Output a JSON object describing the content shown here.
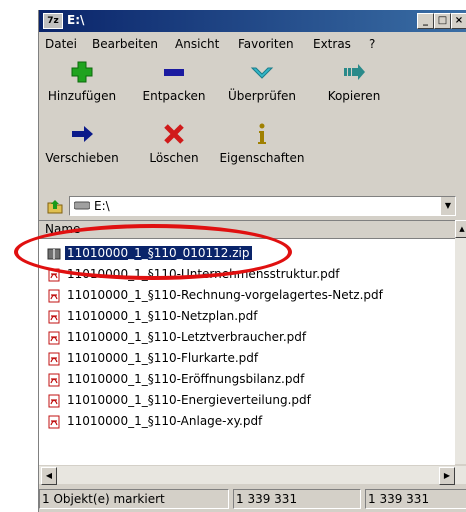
{
  "window": {
    "title": "E:\\",
    "app_icon_text": "7z",
    "min_label": "_",
    "max_label": "□",
    "close_label": "×"
  },
  "menu": [
    {
      "label": "Datei"
    },
    {
      "label": "Bearbeiten"
    },
    {
      "label": "Ansicht"
    },
    {
      "label": "Favoriten"
    },
    {
      "label": "Extras"
    },
    {
      "label": "?"
    }
  ],
  "toolbar": [
    {
      "label": "Hinzufügen",
      "icon": "plus-icon",
      "color": "#1fa31f"
    },
    {
      "label": "Entpacken",
      "icon": "minus-icon",
      "color": "#1a1aa0"
    },
    {
      "label": "Überprüfen",
      "icon": "check-chevron-icon",
      "color": "#33b7c9"
    },
    {
      "label": "Kopieren",
      "icon": "copy-arrow-icon",
      "color": "#2a8a8a"
    },
    {
      "label": "Verschieben",
      "icon": "arrow-right-icon",
      "color": "#0b1a8a"
    },
    {
      "label": "Löschen",
      "icon": "x-icon",
      "color": "#d01a1a"
    },
    {
      "label": "Eigenschaften",
      "icon": "info-icon",
      "color": "#a08000"
    }
  ],
  "address": {
    "value": "E:\\"
  },
  "list": {
    "column_name": "Name",
    "items": [
      {
        "name": "11010000_1_§110_010112.zip",
        "type": "zip",
        "selected": true
      },
      {
        "name": "11010000_1_§110-Unternehmensstruktur.pdf",
        "type": "pdf"
      },
      {
        "name": "11010000_1_§110-Rechnung-vorgelagertes-Netz.pdf",
        "type": "pdf"
      },
      {
        "name": "11010000_1_§110-Netzplan.pdf",
        "type": "pdf"
      },
      {
        "name": "11010000_1_§110-Letztverbraucher.pdf",
        "type": "pdf"
      },
      {
        "name": "11010000_1_§110-Flurkarte.pdf",
        "type": "pdf"
      },
      {
        "name": "11010000_1_§110-Eröffnungsbilanz.pdf",
        "type": "pdf"
      },
      {
        "name": "11010000_1_§110-Energieverteilung.pdf",
        "type": "pdf"
      },
      {
        "name": "11010000_1_§110-Anlage-xy.pdf",
        "type": "pdf"
      }
    ]
  },
  "status": {
    "selection": "1 Objekt(e) markiert",
    "size": "1 339 331",
    "packed": "1 339 331"
  },
  "colors": {
    "title_bar": "#0a246a",
    "selection": "#0a246a",
    "annotation": "#e01010"
  }
}
